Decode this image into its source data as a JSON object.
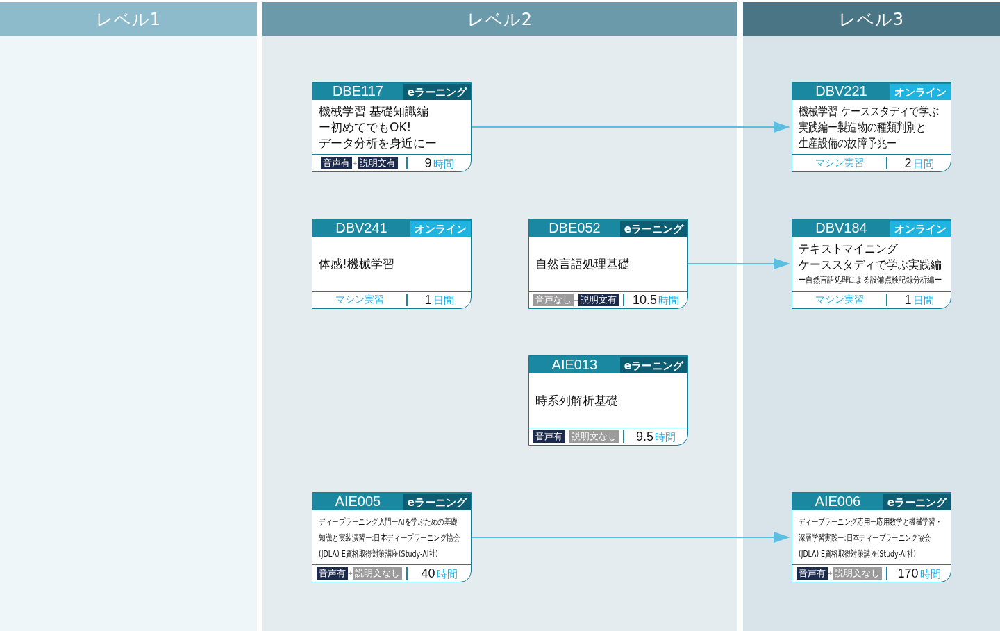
{
  "levels": [
    {
      "label": "レベル1"
    },
    {
      "label": "レベル2"
    },
    {
      "label": "レベル3"
    }
  ],
  "rows": [
    {
      "level_2_left": {
        "code": "DBE117",
        "delivery": {
          "kind": "elearning",
          "label": "eラーニング"
        },
        "title": [
          "機械学習 基礎知識編",
          "ー初めてでもOK!",
          "データ分析を身近にー"
        ],
        "footer": {
          "kind": "tags",
          "tags": [
            {
              "label": "音声有",
              "on": true
            },
            {
              "label": "説明文有",
              "on": true
            }
          ],
          "joiner": "+",
          "amount": "9",
          "unit": "時間"
        }
      },
      "level_3": {
        "code": "DBV221",
        "delivery": {
          "kind": "online",
          "label": "オンライン"
        },
        "title": [
          "機械学習 ケーススタディで学ぶ",
          "実践編ー製造物の種類判別と",
          "生産設備の故障予兆ー"
        ],
        "footer": {
          "kind": "practice",
          "label": "マシン実習",
          "amount": "2",
          "unit": "日間"
        }
      }
    },
    {
      "level_2_left": {
        "code": "DBV241",
        "delivery": {
          "kind": "online",
          "label": "オンライン"
        },
        "title": [
          "体感!機械学習"
        ],
        "footer": {
          "kind": "practice",
          "label": "マシン実習",
          "amount": "1",
          "unit": "日間"
        }
      },
      "level_2_right": {
        "code": "DBE052",
        "delivery": {
          "kind": "elearning",
          "label": "eラーニング"
        },
        "title": [
          "自然言語処理基礎"
        ],
        "footer": {
          "kind": "tags",
          "tags": [
            {
              "label": "音声なし",
              "on": false
            },
            {
              "label": "説明文有",
              "on": true
            }
          ],
          "joiner": "+",
          "amount": "10.5",
          "unit": "時間"
        }
      },
      "level_3": {
        "code": "DBV184",
        "delivery": {
          "kind": "online",
          "label": "オンライン"
        },
        "title": [
          "テキストマイニング",
          "ケーススタディで学ぶ実践編"
        ],
        "subtitle": "ー自然言語処理による設備点検記録分析編ー",
        "footer": {
          "kind": "practice",
          "label": "マシン実習",
          "amount": "1",
          "unit": "日間"
        }
      }
    },
    {
      "level_2_right": {
        "code": "AIE013",
        "delivery": {
          "kind": "elearning",
          "label": "eラーニング"
        },
        "title": [
          "時系列解析基礎"
        ],
        "footer": {
          "kind": "tags",
          "tags": [
            {
              "label": "音声有",
              "on": true
            },
            {
              "label": "説明文なし",
              "on": false
            }
          ],
          "joiner": "+",
          "amount": "9.5",
          "unit": "時間"
        }
      }
    },
    {
      "level_2_left": {
        "code": "AIE005",
        "delivery": {
          "kind": "elearning",
          "label": "eラーニング"
        },
        "title": [
          "ディープラーニング入門ーAIを学ぶための基礎",
          "知識と実装演習ー:日本ディープラーニング協会",
          "(JDLA) E資格取得対策講座(Study-AI社)"
        ],
        "footer": {
          "kind": "tags",
          "tags": [
            {
              "label": "音声有",
              "on": true
            },
            {
              "label": "説明文なし",
              "on": false
            }
          ],
          "joiner": "+",
          "amount": "40",
          "unit": "時間"
        }
      },
      "level_3": {
        "code": "AIE006",
        "delivery": {
          "kind": "elearning",
          "label": "eラーニング"
        },
        "title": [
          "ディープラーニング応用ー応用数学と機械学習・",
          "深層学習実践ー:日本ディープラーニング協会",
          "(JDLA) E資格取得対策講座(Study-AI社)"
        ],
        "footer": {
          "kind": "tags",
          "tags": [
            {
              "label": "音声有",
              "on": true
            },
            {
              "label": "説明文なし",
              "on": false
            }
          ],
          "joiner": "+",
          "amount": "170",
          "unit": "時間"
        }
      }
    }
  ]
}
